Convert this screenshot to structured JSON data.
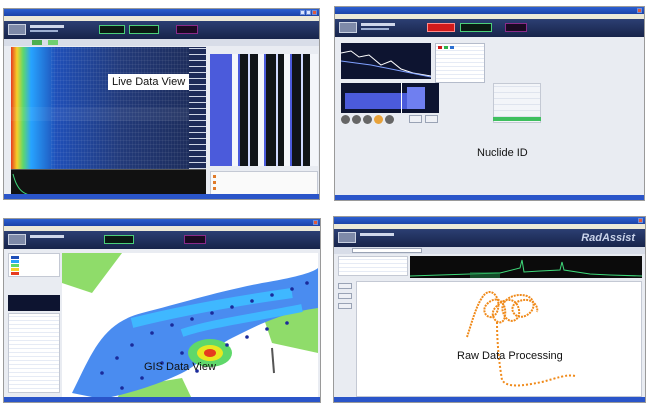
{
  "panels": {
    "live": {
      "caption": "Live Data View"
    },
    "nuclide": {
      "caption": "Nuclide ID"
    },
    "gis": {
      "caption": "GIS Data View"
    },
    "raw": {
      "caption": "Raw Data Processing",
      "brand": "RadAssist"
    }
  },
  "colors": {
    "titlebar": "#1c43a8",
    "header": "#17244a",
    "waterfall_start": "#e63b1f",
    "waterfall_mid": "#27a3ff",
    "spectrum_blue": "#4b5bdb",
    "alarm_red": "#d11a1a",
    "map_road": "#4a8cf0",
    "map_hot": "#e8e820",
    "raw_trace": "#f08a1a",
    "raw_spectrum_green": "#3fd97a"
  },
  "icons": [
    "window-close-icon",
    "window-maximize-icon",
    "window-minimize-icon",
    "app-logo-icon"
  ]
}
